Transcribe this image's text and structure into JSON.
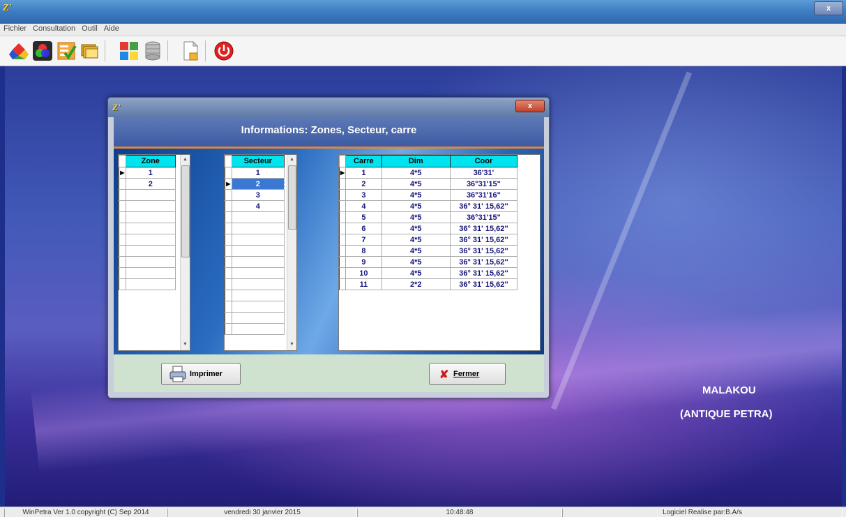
{
  "window": {
    "title_icon": "Z'",
    "close_label": "x"
  },
  "menu": [
    "Fichier",
    "Consultation",
    "Outil",
    "Aide"
  ],
  "toolbar": {
    "icons": [
      "shapes-icon",
      "rgb-circles-icon",
      "checklist-icon",
      "folders-icon",
      "color-grid-icon",
      "database-icon",
      "document-icon",
      "power-icon"
    ],
    "power_color": "#e02020"
  },
  "dialog": {
    "title_icon": "Z'",
    "close_label": "x",
    "header": "Informations: Zones, Secteur, carre",
    "zones": {
      "header": "Zone",
      "rows": [
        "1",
        "2"
      ],
      "current_row": 0
    },
    "secteurs": {
      "header": "Secteur",
      "rows": [
        "1",
        "2",
        "3",
        "4"
      ],
      "current_row": 1
    },
    "carres": {
      "headers": [
        "Carre",
        "Dim",
        "Coor"
      ],
      "current_row": 0,
      "rows": [
        [
          "1",
          "4*5",
          "36'31'"
        ],
        [
          "2",
          "4*5",
          "36°31'15\""
        ],
        [
          "3",
          "4*5",
          "36°31'16\""
        ],
        [
          "4",
          "4*5",
          "36° 31' 15,62''"
        ],
        [
          "5",
          "4*5",
          "36°31'15\""
        ],
        [
          "6",
          "4*5",
          "36° 31' 15,62''"
        ],
        [
          "7",
          "4*5",
          "36° 31' 15,62''"
        ],
        [
          "8",
          "4*5",
          "36° 31' 15,62''"
        ],
        [
          "9",
          "4*5",
          "36° 31' 15,62''"
        ],
        [
          "10",
          "4*5",
          "36° 31' 15,62''"
        ],
        [
          "11",
          "2*2",
          "36° 31' 15,62''"
        ]
      ]
    },
    "buttons": {
      "print": "Imprimer",
      "close": "Fermer"
    }
  },
  "desktop": {
    "line1": "MALAKOU",
    "line2": "(ANTIQUE PETRA)"
  },
  "status": [
    "WinPetra Ver 1.0 copyright (C)  Sep 2014",
    "vendredi 30 janvier 2015",
    "10:48:48",
    "Logiciel Realise par:B.A/s"
  ],
  "colors": {
    "grid_header": "#00e4f0",
    "selected_cell": "#3a78d4",
    "header_accent": "#e0863a",
    "footer_bg": "#cfe2cf"
  }
}
